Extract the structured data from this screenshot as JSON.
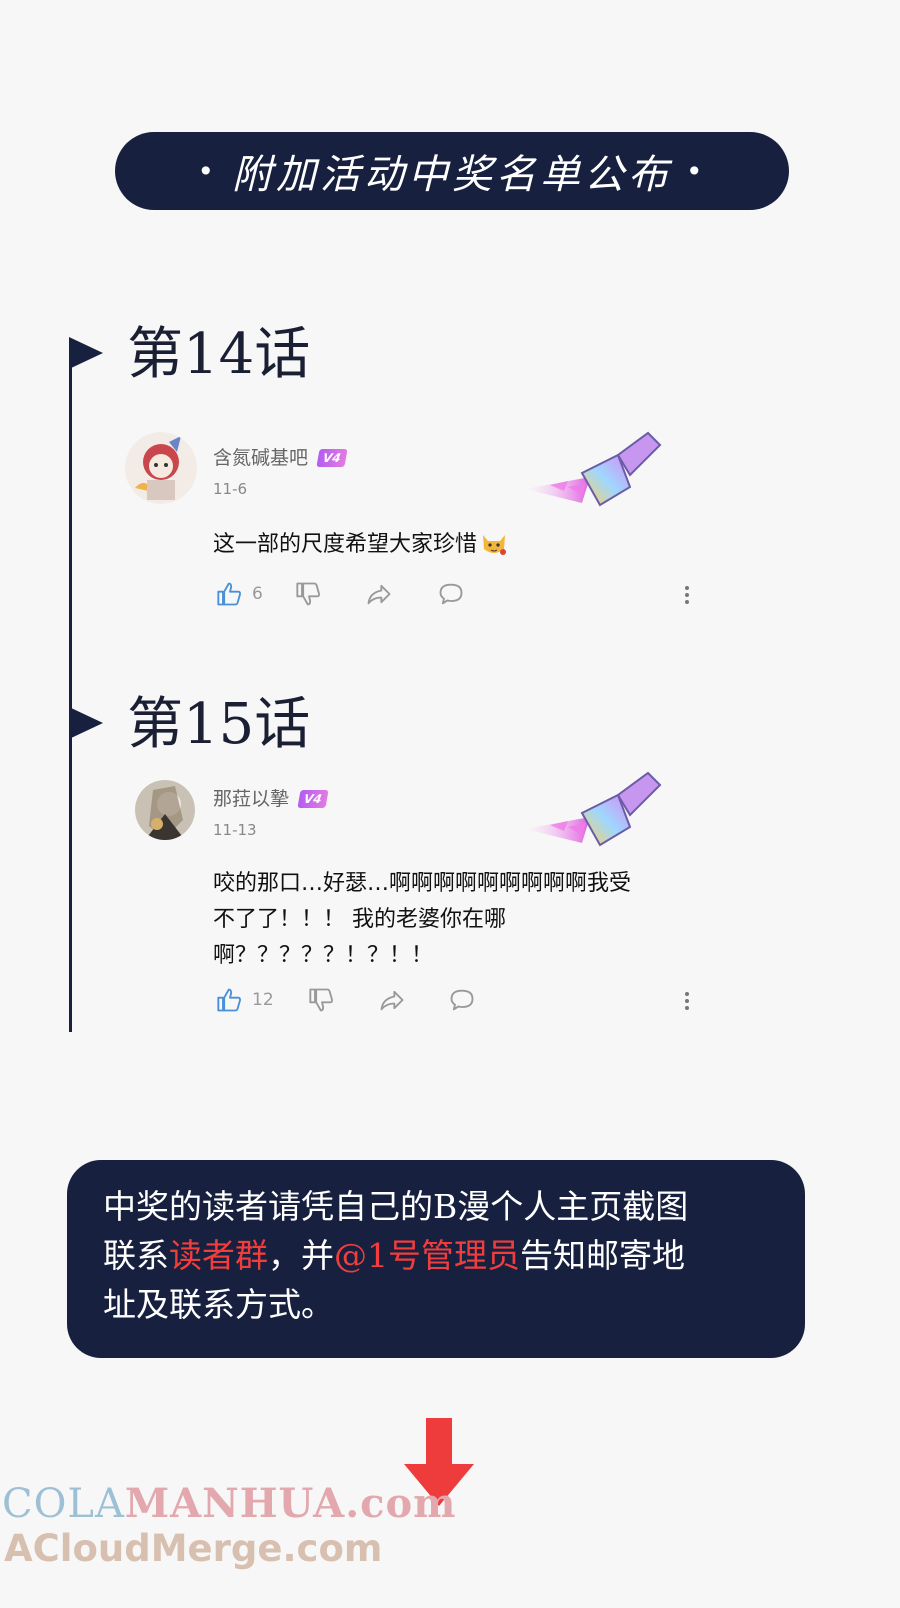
{
  "header": {
    "title": "附加活动中奖名单公布",
    "dot": "•"
  },
  "chapters": [
    {
      "title": "第14话",
      "comment": {
        "username": "含氮碱基吧",
        "level": "V4",
        "date": "11-6",
        "text": "这一部的尺度希望大家珍惜",
        "likes": "6"
      }
    },
    {
      "title": "第15话",
      "comment": {
        "username": "那菈以摯",
        "level": "V4",
        "date": "11-13",
        "text_lines": [
          "咬的那口…好瑟…啊啊啊啊啊啊啊啊啊我受",
          "不了了！！！ 我的老婆你在哪",
          "啊？？？？？！？！！"
        ],
        "likes": "12"
      }
    }
  ],
  "info": {
    "line1": "中奖的读者请凭自己的B漫个人主页截图",
    "line2_pre": "联系",
    "line2_hl1": "读者群",
    "line2_mid": "，并",
    "line2_hl2": "@1号管理员",
    "line2_post": "告知邮寄地",
    "line3": "址及联系方式。"
  },
  "watermark": {
    "part1": "COLA",
    "part2": "MANHUA.com",
    "line2": "ACloudMerge.com"
  },
  "colors": {
    "navy": "#17213f",
    "highlight": "#f23d3d",
    "arrow": "#ee3b3b"
  },
  "icons": [
    "thumb-up-icon",
    "thumb-down-icon",
    "share-icon",
    "comment-icon",
    "more-icon",
    "down-arrow-icon",
    "paintbrush-decoration",
    "cat-emoji"
  ]
}
